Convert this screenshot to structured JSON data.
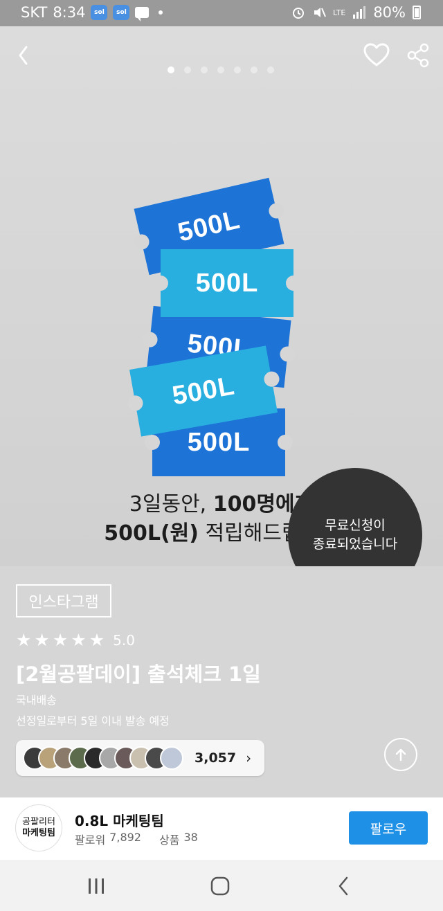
{
  "status_bar": {
    "carrier": "SKT",
    "time": "8:34",
    "app_badges": [
      "sol",
      "sol"
    ],
    "network": "LTE",
    "battery": "80%"
  },
  "hero": {
    "pager": {
      "total": 7,
      "active_index": 0
    },
    "tickets": [
      "500L",
      "500L",
      "500L",
      "500L",
      "500L"
    ],
    "caption_line1_plain": "3일동안, ",
    "caption_line1_bold": "100명에게",
    "caption_line2_bold": "500L(원)",
    "caption_line2_plain": " 적립해드립니다",
    "closed_badge_line1": "무료신청이",
    "closed_badge_line2": "종료되었습니다"
  },
  "product": {
    "tag": "인스타그램",
    "rating": {
      "stars": 5,
      "score": "5.0"
    },
    "title": "[2월공팔데이] 출석체크 1일",
    "shipping": "국내배송",
    "shipping_eta": "선정일로부터 5일 이내 발송 예정",
    "participants_count": "3,057"
  },
  "seller": {
    "logo_line1": "공팔리터",
    "logo_line2": "마케팅팀",
    "name": "0.8L 마케팅팀",
    "followers_label": "팔로워",
    "followers": "7,892",
    "products_label": "상품",
    "products": "38",
    "follow_label": "팔로우"
  },
  "colors": {
    "ticket_dark": "#1d73d6",
    "ticket_light": "#29aee0",
    "follow_button": "#1e90e6",
    "badge_bg": "#333333"
  }
}
